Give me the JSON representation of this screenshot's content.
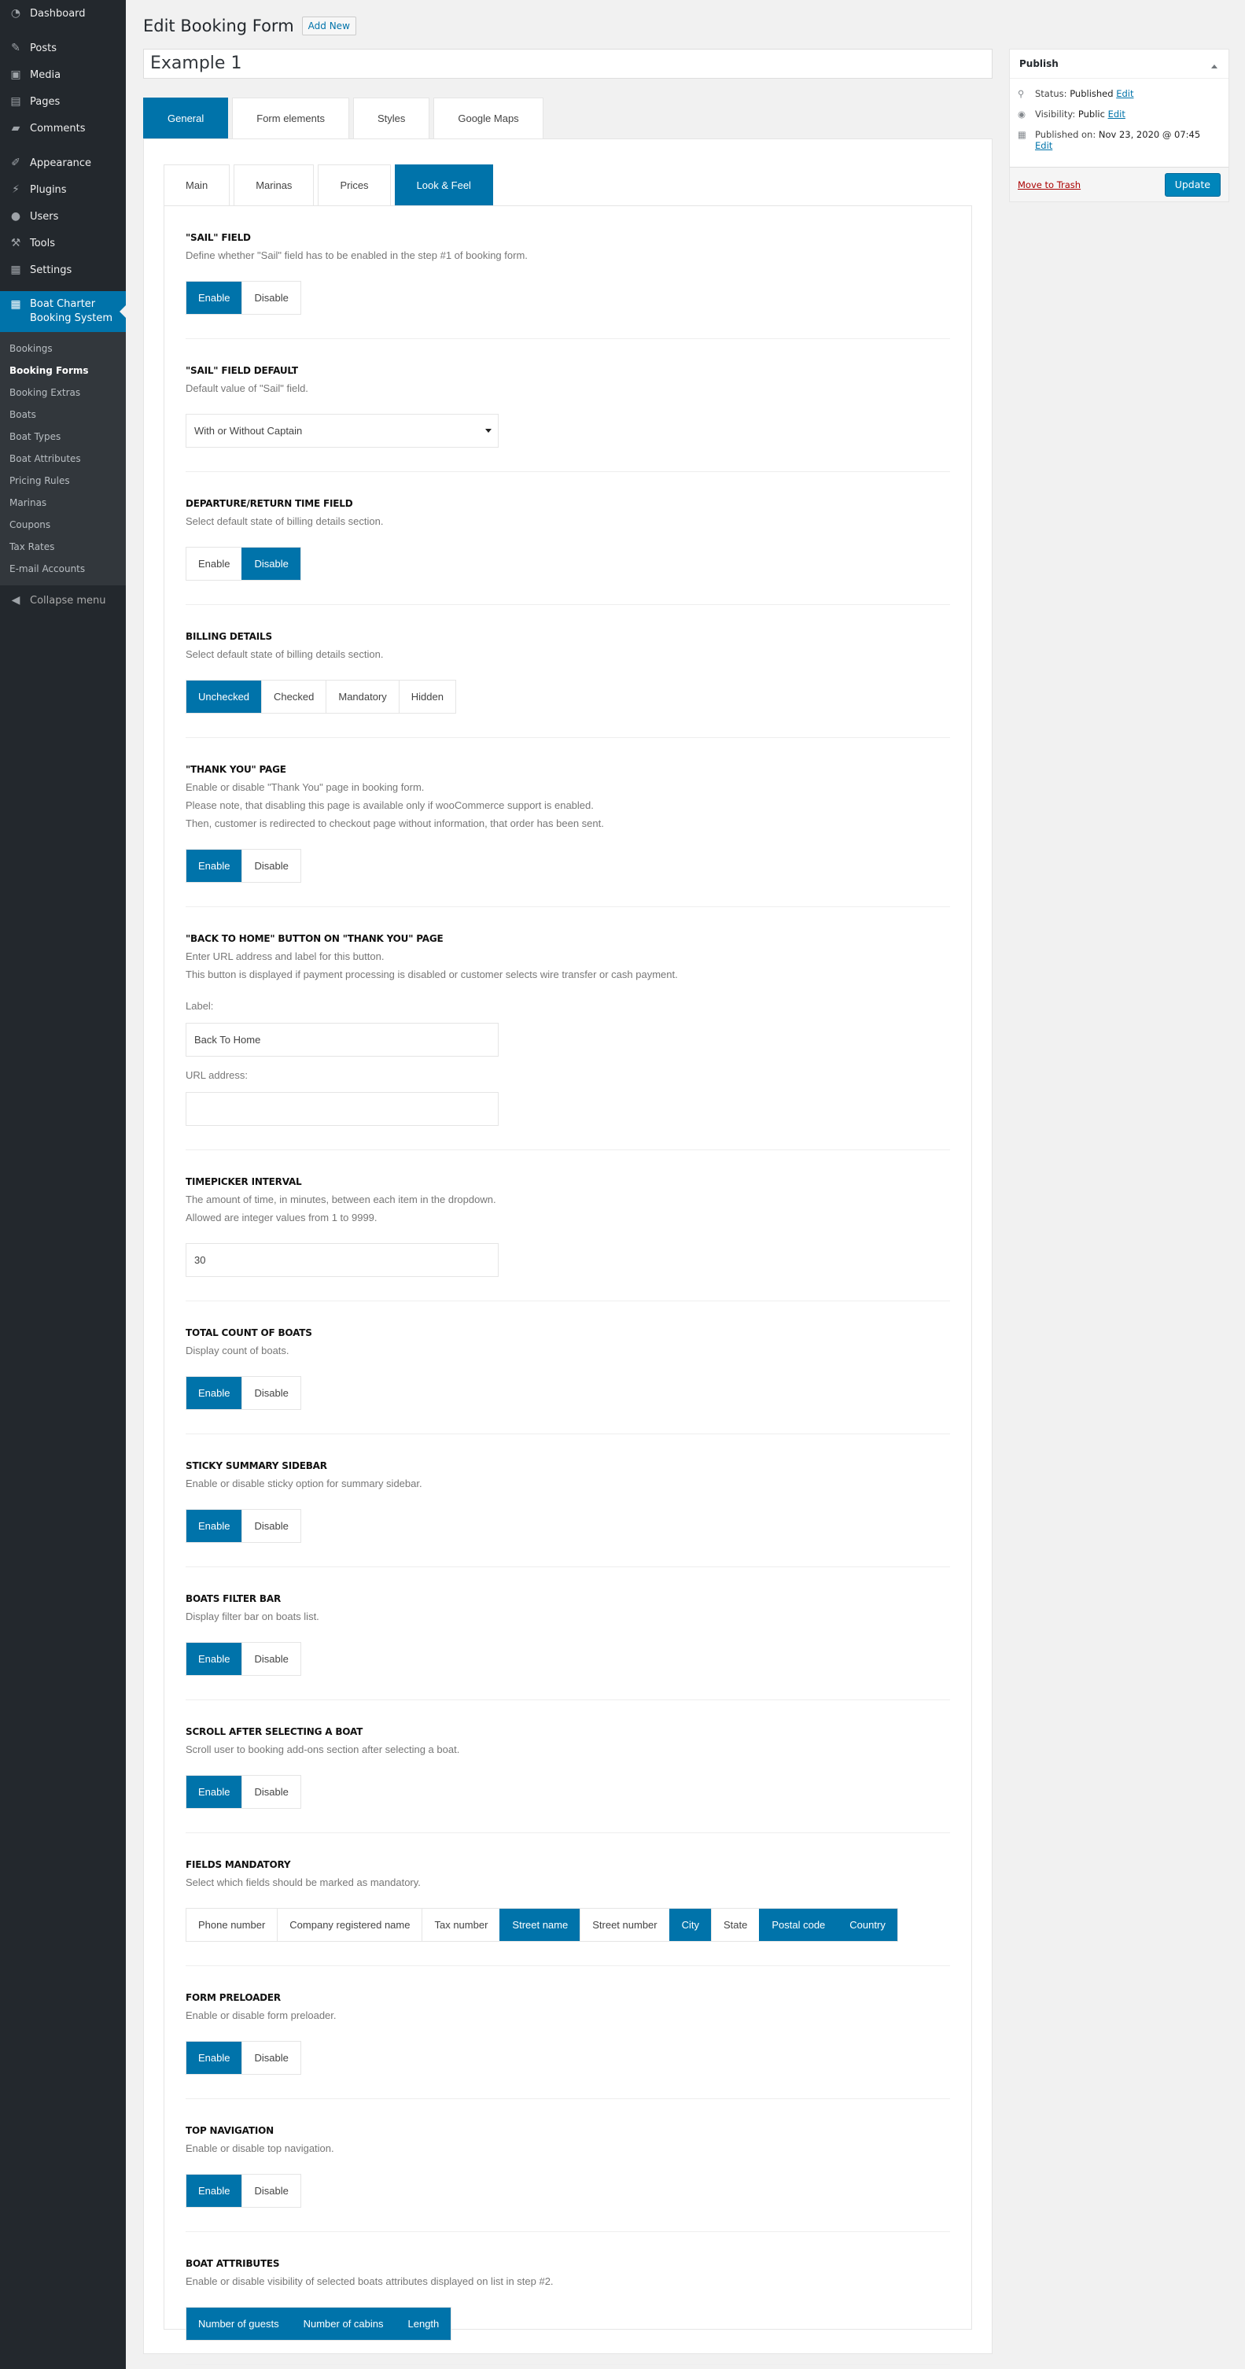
{
  "sidebar": {
    "items": [
      {
        "label": "Dashboard",
        "icon": "dashboard-icon",
        "glyph": "◔"
      },
      {
        "sep": true
      },
      {
        "label": "Posts",
        "icon": "pin-icon",
        "glyph": "✎"
      },
      {
        "label": "Media",
        "icon": "media-icon",
        "glyph": "▣"
      },
      {
        "label": "Pages",
        "icon": "pages-icon",
        "glyph": "▤"
      },
      {
        "label": "Comments",
        "icon": "comment-icon",
        "glyph": "▰"
      },
      {
        "sep": true
      },
      {
        "label": "Appearance",
        "icon": "brush-icon",
        "glyph": "✐"
      },
      {
        "label": "Plugins",
        "icon": "plugin-icon",
        "glyph": "⚡"
      },
      {
        "label": "Users",
        "icon": "user-icon",
        "glyph": "●"
      },
      {
        "label": "Tools",
        "icon": "wrench-icon",
        "glyph": "⚒"
      },
      {
        "label": "Settings",
        "icon": "settings-icon",
        "glyph": "▦"
      },
      {
        "sep": true
      }
    ],
    "active": {
      "label": "Boat Charter Booking System",
      "icon": "calendar-icon",
      "glyph": "▦"
    },
    "submenu": [
      "Bookings",
      "Booking Forms",
      "Booking Extras",
      "Boats",
      "Boat Types",
      "Boat Attributes",
      "Pricing Rules",
      "Marinas",
      "Coupons",
      "Tax Rates",
      "E-mail Accounts"
    ],
    "submenu_current": 1,
    "collapse": "Collapse menu"
  },
  "header": {
    "title": "Edit Booking Form",
    "add_new": "Add New"
  },
  "title_value": "Example 1",
  "tabs": [
    "General",
    "Form elements",
    "Styles",
    "Google Maps"
  ],
  "active_tab": 0,
  "inner_tabs": [
    "Main",
    "Marinas",
    "Prices",
    "Look & Feel"
  ],
  "active_inner_tab": 3,
  "sections": [
    {
      "title": "\"SAIL\" FIELD",
      "desc": [
        "Define whether \"Sail\" field has to be enabled in the step #1 of booking form."
      ],
      "type": "toggle",
      "options": [
        "Enable",
        "Disable"
      ],
      "selected": [
        0
      ]
    },
    {
      "title": "\"SAIL\" FIELD DEFAULT",
      "desc": [
        "Default value of \"Sail\" field."
      ],
      "type": "select",
      "value": "With or Without Captain"
    },
    {
      "title": "DEPARTURE/RETURN TIME FIELD",
      "desc": [
        "Select default state of billing details section."
      ],
      "type": "toggle",
      "options": [
        "Enable",
        "Disable"
      ],
      "selected": [
        1
      ]
    },
    {
      "title": "BILLING DETAILS",
      "desc": [
        "Select default state of billing details section."
      ],
      "type": "toggle",
      "options": [
        "Unchecked",
        "Checked",
        "Mandatory",
        "Hidden"
      ],
      "selected": [
        0
      ]
    },
    {
      "title": "\"THANK YOU\" PAGE",
      "desc": [
        "Enable or disable \"Thank You\" page in booking form.",
        "Please note, that disabling this page is available only if wooCommerce support is enabled.",
        "Then, customer is redirected to checkout page without information, that order has been sent."
      ],
      "type": "toggle",
      "options": [
        "Enable",
        "Disable"
      ],
      "selected": [
        0
      ]
    },
    {
      "title": "\"BACK TO HOME\" BUTTON ON \"THANK YOU\" PAGE",
      "desc": [
        "Enter URL address and label for this button.",
        "This button is displayed if payment processing is disabled or customer selects wire transfer or cash payment."
      ],
      "type": "inputs",
      "fields": [
        {
          "label": "Label:",
          "value": "Back To Home"
        },
        {
          "label": "URL address:",
          "value": ""
        }
      ]
    },
    {
      "title": "TIMEPICKER INTERVAL",
      "desc": [
        "The amount of time, in minutes, between each item in the dropdown.",
        "Allowed are integer values from 1 to 9999."
      ],
      "type": "input",
      "value": "30"
    },
    {
      "title": "TOTAL COUNT OF BOATS",
      "desc": [
        "Display count of boats."
      ],
      "type": "toggle",
      "options": [
        "Enable",
        "Disable"
      ],
      "selected": [
        0
      ]
    },
    {
      "title": "STICKY SUMMARY SIDEBAR",
      "desc": [
        "Enable or disable sticky option for summary sidebar."
      ],
      "type": "toggle",
      "options": [
        "Enable",
        "Disable"
      ],
      "selected": [
        0
      ]
    },
    {
      "title": "BOATS FILTER BAR",
      "desc": [
        "Display filter bar on boats list."
      ],
      "type": "toggle",
      "options": [
        "Enable",
        "Disable"
      ],
      "selected": [
        0
      ]
    },
    {
      "title": "SCROLL AFTER SELECTING A BOAT",
      "desc": [
        "Scroll user to booking add-ons section after selecting a boat."
      ],
      "type": "toggle",
      "options": [
        "Enable",
        "Disable"
      ],
      "selected": [
        0
      ]
    },
    {
      "title": "FIELDS MANDATORY",
      "desc": [
        "Select which fields should be marked as mandatory."
      ],
      "type": "toggle",
      "options": [
        "Phone number",
        "Company registered name",
        "Tax number",
        "Street name",
        "Street number",
        "City",
        "State",
        "Postal code",
        "Country"
      ],
      "selected": [
        3,
        5,
        7,
        8
      ]
    },
    {
      "title": "FORM PRELOADER",
      "desc": [
        "Enable or disable form preloader."
      ],
      "type": "toggle",
      "options": [
        "Enable",
        "Disable"
      ],
      "selected": [
        0
      ]
    },
    {
      "title": "TOP NAVIGATION",
      "desc": [
        "Enable or disable top navigation."
      ],
      "type": "toggle",
      "options": [
        "Enable",
        "Disable"
      ],
      "selected": [
        0
      ]
    },
    {
      "title": "BOAT ATTRIBUTES",
      "desc": [
        "Enable or disable visibility of selected boats attributes displayed on list in step #2."
      ],
      "type": "toggle",
      "options": [
        "Number of guests",
        "Number of cabins",
        "Length"
      ],
      "selected": [
        0,
        1,
        2
      ]
    }
  ],
  "publish": {
    "title": "Publish",
    "status_label": "Status:",
    "status": "Published",
    "visibility_label": "Visibility:",
    "visibility": "Public",
    "published_label": "Published on:",
    "published": "Nov 23, 2020 @ 07:45",
    "edit": "Edit",
    "trash": "Move to Trash",
    "update": "Update"
  },
  "colors": {
    "accent": "#0073aa",
    "sidebar": "#23282d",
    "submenu": "#32373c"
  }
}
